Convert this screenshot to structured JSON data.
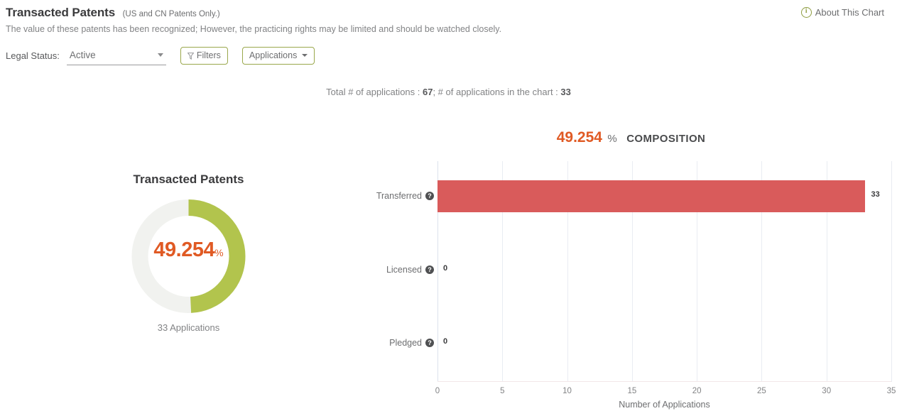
{
  "header": {
    "title": "Transacted Patents",
    "subtitle": "(US and CN Patents Only.)",
    "description": "The value of these patents has been recognized; However, the practicing rights may be limited and should be watched closely.",
    "about_label": "About This Chart",
    "about_icon": "info-circle-icon"
  },
  "controls": {
    "legal_status_label": "Legal Status:",
    "legal_status_value": "Active",
    "legal_status_options": [
      "Active"
    ],
    "filters_label": "Filters",
    "filters_icon": "funnel-icon",
    "applications_label": "Applications",
    "applications_icon": "chevron-down-icon"
  },
  "totals": {
    "prefix": "Total # of applications : ",
    "total": "67",
    "middle": "; # of applications in the chart : ",
    "in_chart": "33"
  },
  "composition": {
    "value": "49.254",
    "percent_symbol": "%",
    "label": "COMPOSITION"
  },
  "donut": {
    "title": "Transacted Patents",
    "value": "49.254",
    "percent_symbol": "%",
    "caption": "33 Applications",
    "percent": 49.254,
    "arc_color": "#b2c44d",
    "track_color": "#f1f2ef",
    "value_color": "#e05a24"
  },
  "colors": {
    "bar": "#d95b5b",
    "accent_orange": "#e05a24",
    "olive": "#9aa84c",
    "gridline": "#e9ecf2"
  },
  "chart_data": {
    "type": "bar",
    "orientation": "horizontal",
    "title": "",
    "categories": [
      "Transferred",
      "Licensed",
      "Pledged"
    ],
    "values": [
      33,
      0,
      0
    ],
    "data_labels": [
      "33",
      "0",
      "0"
    ],
    "xlabel": "Number of Applications",
    "ylabel": "",
    "xlim": [
      0,
      35
    ],
    "xticks": [
      0,
      5,
      10,
      15,
      20,
      25,
      30,
      35
    ],
    "xtick_labels": [
      "0",
      "5",
      "10",
      "15",
      "20",
      "25",
      "30",
      "35"
    ],
    "grid": true,
    "legend": false,
    "series_color": "#d95b5b",
    "category_help_icons": [
      "help-icon",
      "help-icon",
      "help-icon"
    ]
  }
}
